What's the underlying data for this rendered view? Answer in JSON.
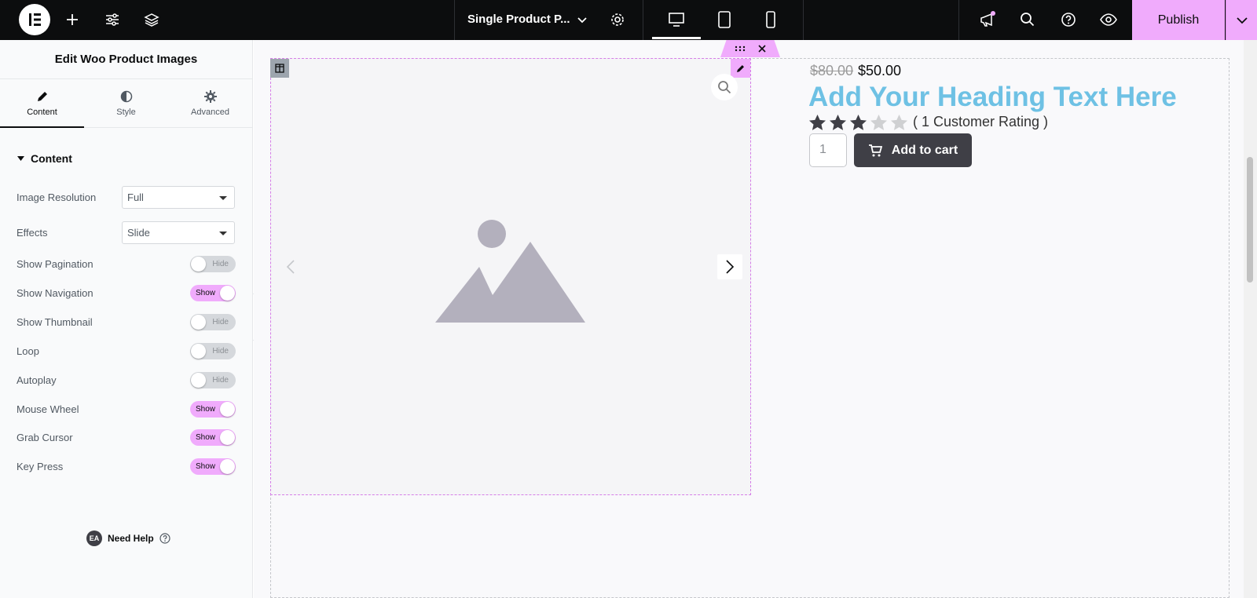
{
  "topbar": {
    "page_title": "Single Product P...",
    "publish_label": "Publish",
    "icons": [
      "elementor-logo-icon",
      "plus-icon",
      "sliders-icon",
      "layers-icon",
      "chevron-down-icon",
      "gear-icon",
      "desktop-icon",
      "tablet-icon",
      "mobile-icon",
      "megaphone-icon",
      "search-icon",
      "help-icon",
      "eye-icon"
    ]
  },
  "panel": {
    "title": "Edit Woo Product Images",
    "tabs": [
      {
        "label": "Content",
        "icon": "pencil-icon"
      },
      {
        "label": "Style",
        "icon": "contrast-icon"
      },
      {
        "label": "Advanced",
        "icon": "gear-icon"
      }
    ],
    "section_title": "Content",
    "controls": {
      "image_resolution": {
        "label": "Image Resolution",
        "value": "Full"
      },
      "effects": {
        "label": "Effects",
        "value": "Slide"
      },
      "show_pagination": {
        "label": "Show Pagination",
        "state": "Hide"
      },
      "show_navigation": {
        "label": "Show Navigation",
        "state": "Show"
      },
      "show_thumbnail": {
        "label": "Show Thumbnail",
        "state": "Hide"
      },
      "loop": {
        "label": "Loop",
        "state": "Hide"
      },
      "autoplay": {
        "label": "Autoplay",
        "state": "Hide"
      },
      "mouse_wheel": {
        "label": "Mouse Wheel",
        "state": "Show"
      },
      "grab_cursor": {
        "label": "Grab Cursor",
        "state": "Show"
      },
      "key_press": {
        "label": "Key Press",
        "state": "Show"
      }
    },
    "need_help": {
      "badge": "EA",
      "label": "Need Help"
    }
  },
  "canvas": {
    "price_old": "$80.00",
    "price_new": "$50.00",
    "heading": "Add Your Heading Text Here",
    "rating": {
      "stars": 3,
      "max": 5,
      "text": "( 1 Customer Rating )"
    },
    "quantity": "1",
    "add_to_cart": "Add to cart"
  },
  "colors": {
    "accent": "#f0abfc",
    "heading": "#6ec1e4",
    "button": "#3f3f46",
    "topbar": "#0c0d0e"
  }
}
